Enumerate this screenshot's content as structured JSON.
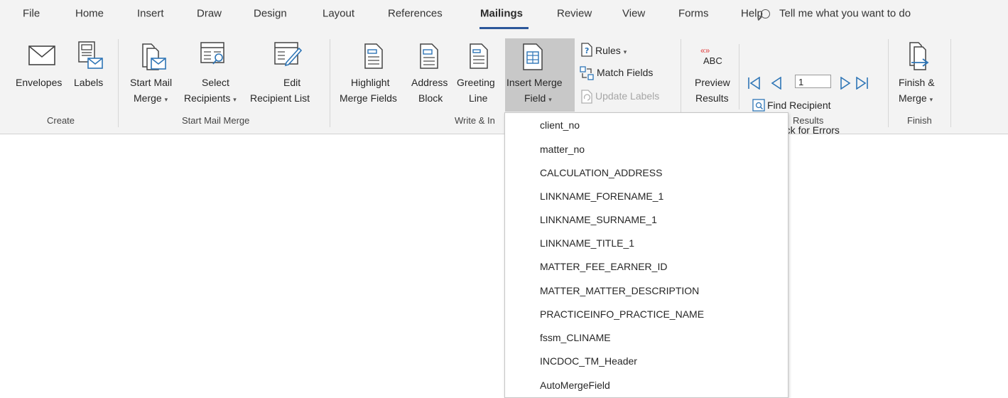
{
  "tabs": {
    "items": [
      "File",
      "Home",
      "Insert",
      "Draw",
      "Design",
      "Layout",
      "References",
      "Mailings",
      "Review",
      "View",
      "Forms",
      "Help"
    ],
    "active": "Mailings",
    "tell_me": "Tell me what you want to do"
  },
  "ribbon": {
    "create": {
      "envelopes": "Envelopes",
      "labels": "Labels",
      "group_label": "Create"
    },
    "start_mail_merge": {
      "start_line1": "Start Mail",
      "start_line2": "Merge",
      "select_line1": "Select",
      "select_line2": "Recipients",
      "edit_line1": "Edit",
      "edit_line2": "Recipient List",
      "group_label": "Start Mail Merge"
    },
    "write_insert": {
      "highlight_line1": "Highlight",
      "highlight_line2": "Merge Fields",
      "address_line1": "Address",
      "address_line2": "Block",
      "greeting_line1": "Greeting",
      "greeting_line2": "Line",
      "insert_line1": "Insert Merge",
      "insert_line2": "Field",
      "rules": "Rules",
      "match_fields": "Match Fields",
      "update_labels": "Update Labels",
      "group_label": "Write & In"
    },
    "preview": {
      "abc": "ABC",
      "preview_line1": "Preview",
      "preview_line2": "Results",
      "record_value": "1",
      "find_recipient": "Find Recipient",
      "check_errors": "Check for Errors",
      "group_label": "Results"
    },
    "finish": {
      "finish_line1": "Finish &",
      "finish_line2": "Merge",
      "group_label": "Finish"
    }
  },
  "merge_fields": [
    "client_no",
    "matter_no",
    "CALCULATION_ADDRESS",
    "LINKNAME_FORENAME_1",
    "LINKNAME_SURNAME_1",
    "LINKNAME_TITLE_1",
    "MATTER_FEE_EARNER_ID",
    "MATTER_MATTER_DESCRIPTION",
    "PRACTICEINFO_PRACTICE_NAME",
    "fssm_CLINAME",
    "INCDOC_TM_Header",
    "AutoMergeField"
  ],
  "colors": {
    "ribbon_bg": "#f3f3f3",
    "accent": "#2b579a",
    "icon_blue": "#2e75b6",
    "highlight": "#c8c8c8"
  }
}
